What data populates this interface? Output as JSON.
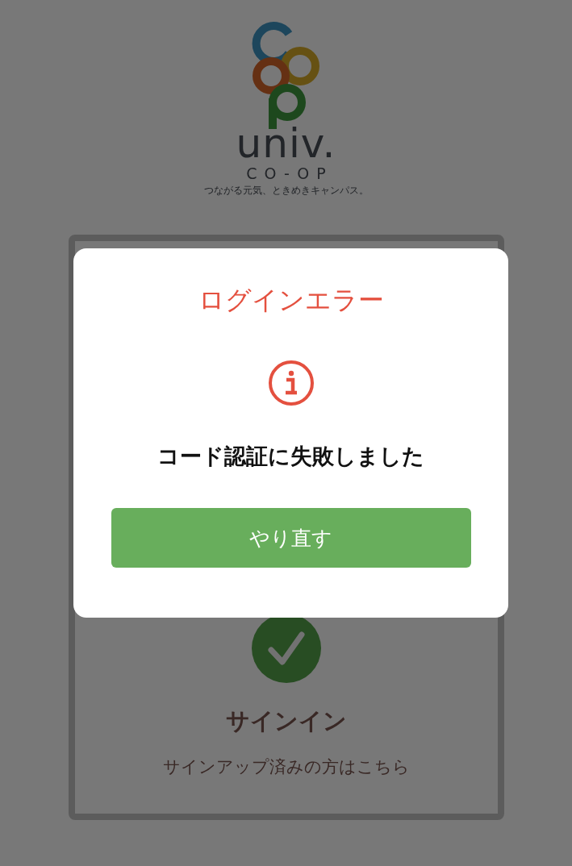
{
  "logo": {
    "wordmark": "univ.",
    "subtitle": "CO-OP",
    "tagline": "つながる元気、ときめきキャンパス。"
  },
  "signin_card": {
    "title": "サインイン",
    "subtitle": "サインアップ済みの方はこちら"
  },
  "dialog": {
    "title": "ログインエラー",
    "message": "コード認証に失敗しました",
    "button": "やり直す"
  }
}
